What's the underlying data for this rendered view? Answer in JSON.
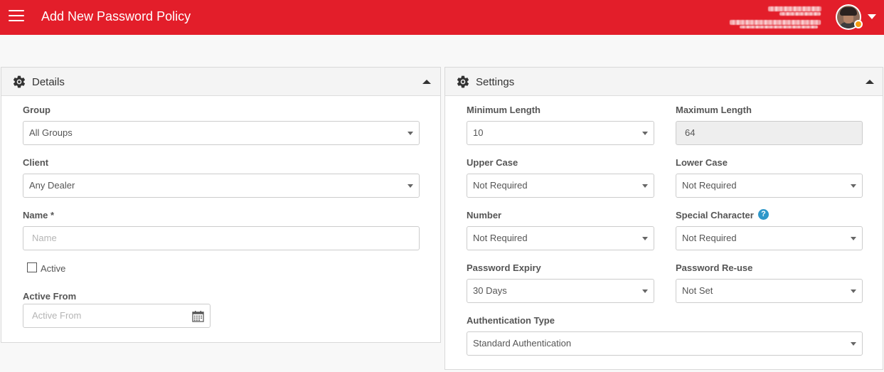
{
  "header": {
    "title": "Add New Password Policy",
    "accent_color": "#e31e2a",
    "menu_icon": "hamburger-menu-icon",
    "user_caret_icon": "caret-down-icon"
  },
  "details": {
    "title": "Details",
    "icon": "gear-icon",
    "group": {
      "label": "Group",
      "value": "All Groups"
    },
    "client": {
      "label": "Client",
      "value": "Any Dealer"
    },
    "name": {
      "label": "Name *",
      "placeholder": "Name",
      "value": ""
    },
    "active": {
      "label": "Active",
      "checked": false
    },
    "active_from": {
      "label": "Active From",
      "placeholder": "Active From",
      "value": ""
    }
  },
  "settings": {
    "title": "Settings",
    "icon": "gear-icon",
    "min_length": {
      "label": "Minimum Length",
      "value": "10"
    },
    "max_length": {
      "label": "Maximum Length",
      "value": "64"
    },
    "upper_case": {
      "label": "Upper Case",
      "value": "Not Required"
    },
    "lower_case": {
      "label": "Lower Case",
      "value": "Not Required"
    },
    "number": {
      "label": "Number",
      "value": "Not Required"
    },
    "special_char": {
      "label": "Special Character",
      "value": "Not Required",
      "help_symbol": "?"
    },
    "expiry": {
      "label": "Password Expiry",
      "value": "30 Days"
    },
    "reuse": {
      "label": "Password Re-use",
      "value": "Not Set"
    },
    "auth_type": {
      "label": "Authentication Type",
      "value": "Standard Authentication"
    }
  }
}
